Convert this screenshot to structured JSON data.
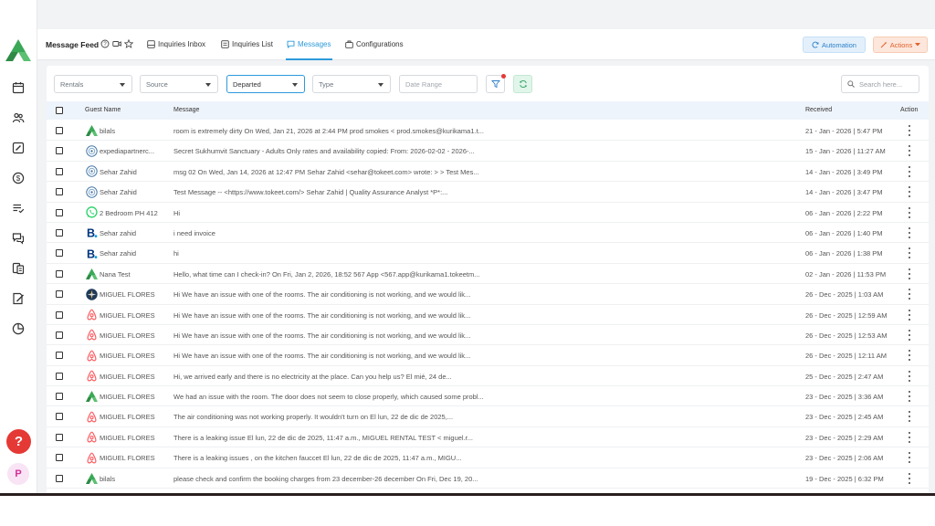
{
  "header": {
    "title": "Message Feed",
    "tabs": [
      {
        "label": "Inquiries Inbox",
        "icon": "inbox-icon"
      },
      {
        "label": "Inquiries List",
        "icon": "list-icon"
      },
      {
        "label": "Messages",
        "icon": "chat-icon",
        "active": true
      },
      {
        "label": "Configurations",
        "icon": "config-icon"
      }
    ],
    "automation_label": "Automation",
    "actions_label": "Actions"
  },
  "filters": {
    "rentals": "Rentals",
    "source": "Source",
    "status": "Departed",
    "type": "Type",
    "date_range": "Date Range",
    "search_placeholder": "Search here..."
  },
  "table": {
    "columns": {
      "guest_name": "Guest Name",
      "message": "Message",
      "received": "Received",
      "action": "Action"
    },
    "rows": [
      {
        "source": "tokeet",
        "guest": "bilals",
        "message": "room is extremely dirty On Wed, Jan 21, 2026 at 2:44 PM prod smokes < prod.smokes@kurikama1.t...",
        "received": "21 - Jan - 2026 | 5:47 PM"
      },
      {
        "source": "expedia",
        "guest": "expediapartnerc...",
        "message": "Secret Sukhumvit Sanctuary - Adults Only rates and availability copied: From: 2026-02-02 - 2026-...",
        "received": "15 - Jan - 2026 | 11:27 AM"
      },
      {
        "source": "expedia",
        "guest": "Sehar Zahid",
        "message": "msg 02 On Wed, Jan 14, 2026 at 12:47 PM Sehar Zahid <sehar@tokeet.com> wrote: > > Test Mes...",
        "received": "14 - Jan - 2026 | 3:49 PM"
      },
      {
        "source": "expedia",
        "guest": "Sehar Zahid",
        "message": "Test Message -- <https://www.tokeet.com/> Sehar Zahid | Quality Assurance Analyst *P*:...",
        "received": "14 - Jan - 2026 | 3:47 PM"
      },
      {
        "source": "whatsapp",
        "guest": "2 Bedroom PH 412",
        "message": "Hi",
        "received": "06 - Jan - 2026 | 2:22 PM"
      },
      {
        "source": "booking",
        "guest": "Sehar zahid",
        "message": "i need invoice",
        "received": "06 - Jan - 2026 | 1:40 PM"
      },
      {
        "source": "booking",
        "guest": "Sehar zahid",
        "message": "hi",
        "received": "06 - Jan - 2026 | 1:38 PM"
      },
      {
        "source": "tokeet",
        "guest": "Nana Test",
        "message": "Hello, what time can I check-in? On Fri, Jan 2, 2026, 18:52 567 App <567.app@kurikama1.tokeetm...",
        "received": "02 - Jan - 2026 | 11:53 PM"
      },
      {
        "source": "compass",
        "guest": "MIGUEL FLORES",
        "message": "Hi We have an issue with one of the rooms. The air conditioning is not working, and we would lik...",
        "received": "26 - Dec - 2025 | 1:03 AM"
      },
      {
        "source": "airbnb",
        "guest": "MIGUEL FLORES",
        "message": "Hi We have an issue with one of the rooms. The air conditioning is not working, and we would lik...",
        "received": "26 - Dec - 2025 | 12:59 AM"
      },
      {
        "source": "airbnb",
        "guest": "MIGUEL FLORES",
        "message": "Hi We have an issue with one of the rooms. The air conditioning is not working, and we would lik...",
        "received": "26 - Dec - 2025 | 12:53 AM"
      },
      {
        "source": "airbnb",
        "guest": "MIGUEL FLORES",
        "message": "Hi We have an issue with one of the rooms. The air conditioning is not working, and we would lik...",
        "received": "26 - Dec - 2025 | 12:11 AM"
      },
      {
        "source": "airbnb",
        "guest": "MIGUEL FLORES",
        "message": "Hi, we arrived early and there is no electricity at the place. Can you help us? El mié, 24 de...",
        "received": "25 - Dec - 2025 | 2:47 AM"
      },
      {
        "source": "tokeet",
        "guest": "MIGUEL FLORES",
        "message": "We had an issue with the room. The door does not seem to close properly, which caused some probl...",
        "received": "23 - Dec - 2025 | 3:36 AM"
      },
      {
        "source": "airbnb",
        "guest": "MIGUEL FLORES",
        "message": "The air conditioning was not working properly. It wouldn't turn on El lun, 22 de dic de 2025,...",
        "received": "23 - Dec - 2025 | 2:45 AM"
      },
      {
        "source": "airbnb",
        "guest": "MIGUEL FLORES",
        "message": "There is a leaking issue El lun, 22 de dic de 2025, 11:47 a.m., MIGUEL RENTAL TEST < miguel.r...",
        "received": "23 - Dec - 2025 | 2:29 AM"
      },
      {
        "source": "airbnb",
        "guest": "MIGUEL FLORES",
        "message": "There is a leaking issues , on the kitchen fauccet El lun, 22 de dic de 2025, 11:47 a.m., MIGU...",
        "received": "23 - Dec - 2025 | 2:06 AM"
      },
      {
        "source": "tokeet",
        "guest": "bilals",
        "message": "please check and confirm the booking charges from 23 december-26 december On Fri, Dec 19, 20...",
        "received": "19 - Dec - 2025 | 6:32 PM"
      }
    ]
  },
  "sidebar": {
    "help_label": "?",
    "avatar_label": "P",
    "icons": [
      "calendar-icon",
      "users-icon",
      "edit-icon",
      "dollar-icon",
      "tasks-icon",
      "messages-icon",
      "documents-icon",
      "review-icon",
      "reports-icon"
    ]
  },
  "colors": {
    "accent": "#2c9adb",
    "tokeet_green": "#3aa856",
    "airbnb_red": "#ff5a5f",
    "booking_blue": "#003580",
    "help_red": "#e53935"
  }
}
